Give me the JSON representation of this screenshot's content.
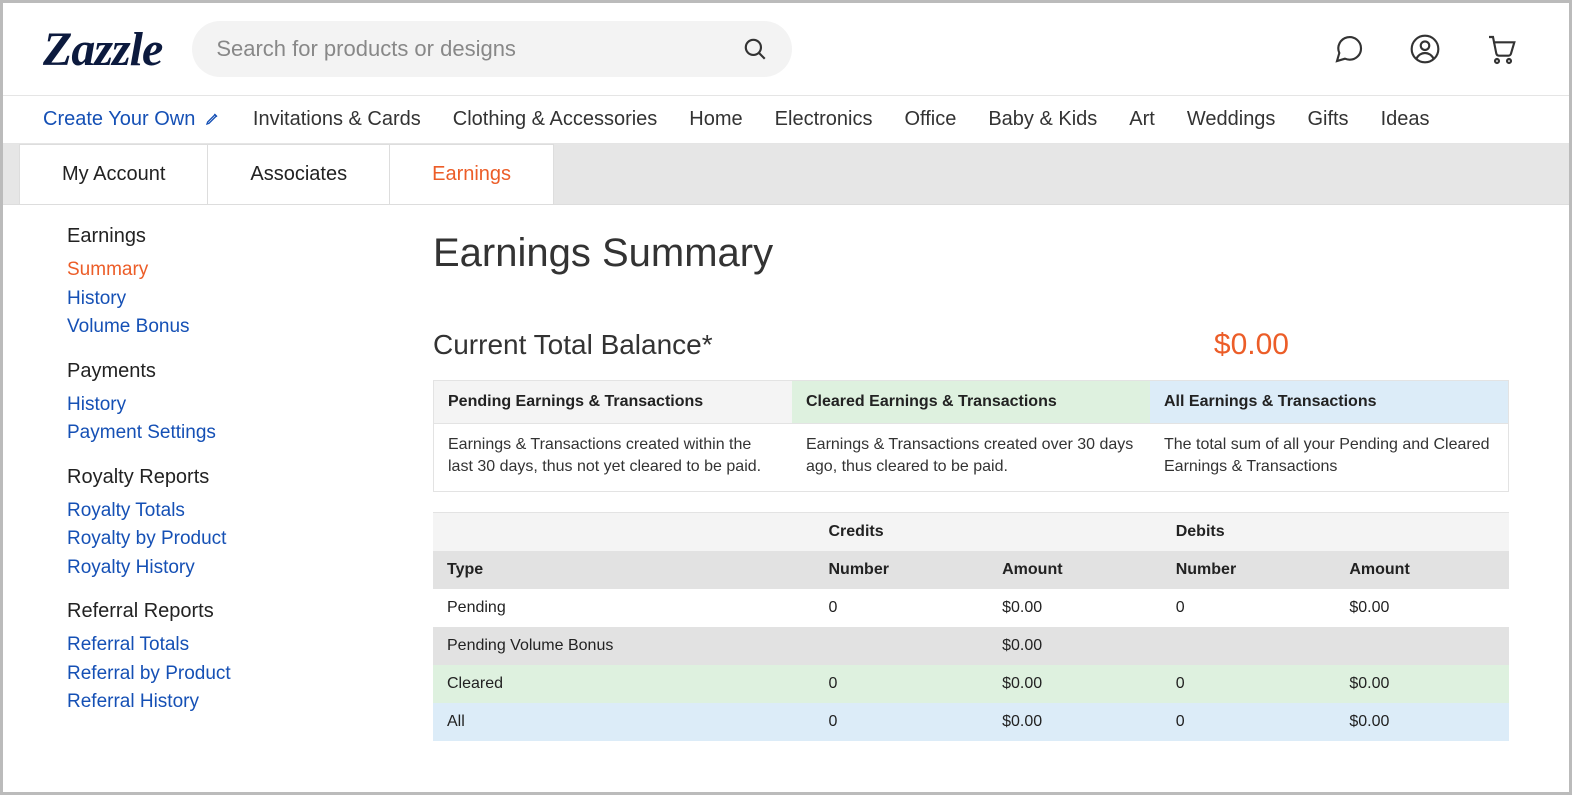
{
  "header": {
    "logo": "Zazzle",
    "search_placeholder": "Search for products or designs"
  },
  "nav": {
    "create": "Create Your Own",
    "items": [
      "Invitations & Cards",
      "Clothing & Accessories",
      "Home",
      "Electronics",
      "Office",
      "Baby & Kids",
      "Art",
      "Weddings",
      "Gifts",
      "Ideas"
    ]
  },
  "tabs": [
    "My Account",
    "Associates",
    "Earnings"
  ],
  "sidebar": {
    "groups": [
      {
        "title": "Earnings",
        "links": [
          "Summary",
          "History",
          "Volume Bonus"
        ]
      },
      {
        "title": "Payments",
        "links": [
          "History",
          "Payment Settings"
        ]
      },
      {
        "title": "Royalty Reports",
        "links": [
          "Royalty Totals",
          "Royalty by Product",
          "Royalty History"
        ]
      },
      {
        "title": "Referral Reports",
        "links": [
          "Referral Totals",
          "Referral by Product",
          "Referral History"
        ]
      }
    ]
  },
  "content": {
    "title": "Earnings Summary",
    "balance_label": "Current Total Balance*",
    "balance_value": "$0.00",
    "legend": [
      {
        "head": "Pending Earnings & Transactions",
        "body": "Earnings & Transactions created within the last 30 days, thus not yet cleared to be paid."
      },
      {
        "head": "Cleared Earnings & Transactions",
        "body": "Earnings & Transactions created over 30 days ago, thus cleared to be paid."
      },
      {
        "head": "All Earnings & Transactions",
        "body": "The total sum of all your Pending and Cleared Earnings & Transactions"
      }
    ],
    "table": {
      "super_headers": {
        "credits": "Credits",
        "debits": "Debits"
      },
      "sub_headers": {
        "type": "Type",
        "number": "Number",
        "amount": "Amount"
      },
      "rows": [
        {
          "type": "Pending",
          "c_num": "0",
          "c_amt": "$0.00",
          "d_num": "0",
          "d_amt": "$0.00"
        },
        {
          "type": "Pending Volume Bonus",
          "c_num": "",
          "c_amt": "$0.00",
          "d_num": "",
          "d_amt": ""
        },
        {
          "type": "Cleared",
          "c_num": "0",
          "c_amt": "$0.00",
          "d_num": "0",
          "d_amt": "$0.00"
        },
        {
          "type": "All",
          "c_num": "0",
          "c_amt": "$0.00",
          "d_num": "0",
          "d_amt": "$0.00"
        }
      ]
    }
  }
}
